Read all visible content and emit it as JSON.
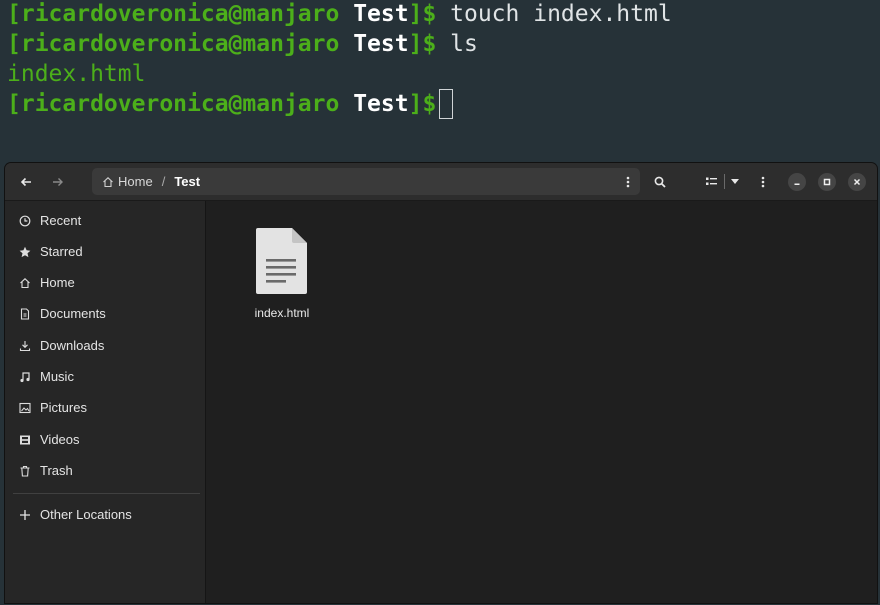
{
  "terminal": {
    "lines": [
      {
        "user": "[ricardoveronica@manjaro",
        "dir": "Test",
        "sym": "]$",
        "cmd": " touch index.html"
      },
      {
        "user": "[ricardoveronica@manjaro",
        "dir": "Test",
        "sym": "]$",
        "cmd": " ls"
      },
      {
        "output": "index.html"
      },
      {
        "user": "[ricardoveronica@manjaro",
        "dir": "Test",
        "sym": "]$",
        "cmd": ""
      }
    ]
  },
  "file_manager": {
    "path": {
      "home": "Home",
      "separator": "/",
      "current": "Test"
    },
    "sidebar": {
      "items": [
        {
          "label": "Recent",
          "icon": "clock-icon"
        },
        {
          "label": "Starred",
          "icon": "star-icon"
        },
        {
          "label": "Home",
          "icon": "home-icon"
        },
        {
          "label": "Documents",
          "icon": "document-icon"
        },
        {
          "label": "Downloads",
          "icon": "download-icon"
        },
        {
          "label": "Music",
          "icon": "music-icon"
        },
        {
          "label": "Pictures",
          "icon": "picture-icon"
        },
        {
          "label": "Videos",
          "icon": "video-icon"
        },
        {
          "label": "Trash",
          "icon": "trash-icon"
        }
      ],
      "other_locations": {
        "label": "Other Locations",
        "icon": "plus-icon"
      }
    },
    "files": [
      {
        "name": "index.html",
        "icon": "text-file-icon"
      }
    ]
  },
  "colors": {
    "terminal_bg": "#263238",
    "prompt_green": "#4caf1a",
    "fm_bg": "#202020",
    "sidebar_bg": "#262626"
  }
}
